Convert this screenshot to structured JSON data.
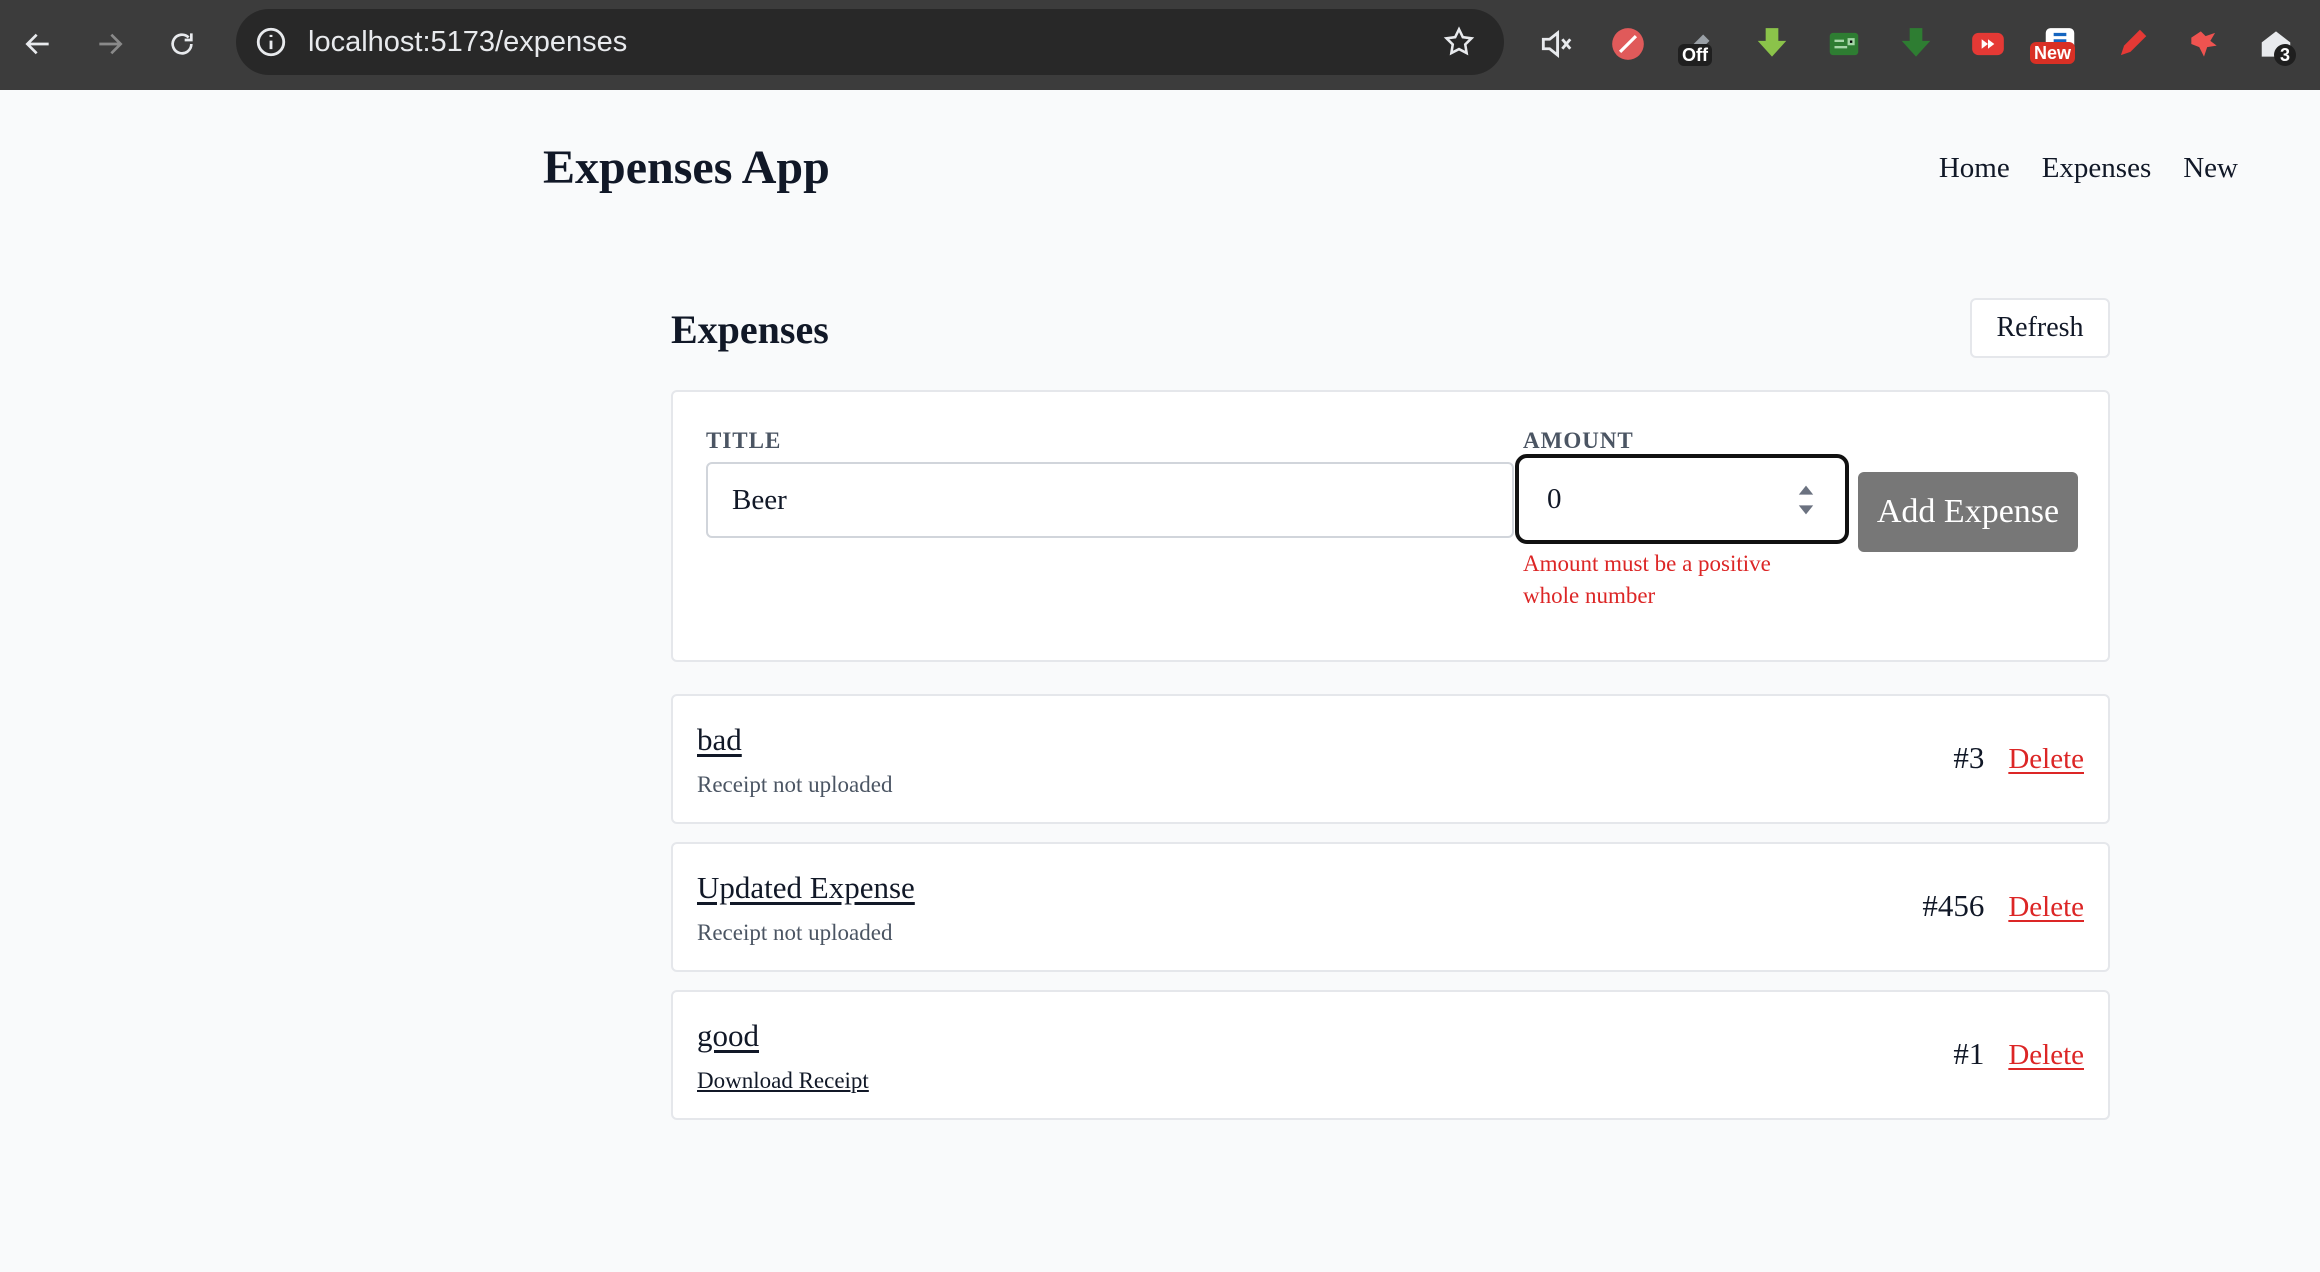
{
  "browser": {
    "url": "localhost:5173/expenses",
    "extensions": {
      "off_badge": "Off",
      "new_badge": "New",
      "count_badge": "3"
    }
  },
  "app": {
    "title": "Expenses App",
    "nav": [
      "Home",
      "Expenses",
      "New"
    ]
  },
  "page": {
    "title": "Expenses",
    "refresh_label": "Refresh"
  },
  "form": {
    "title_label": "TITLE",
    "title_value": "Beer",
    "amount_label": "AMOUNT",
    "amount_value": "0",
    "error": "Amount must be a positive whole number",
    "submit_label": "Add Expense"
  },
  "expenses": [
    {
      "title": "bad",
      "subtitle": "Receipt not uploaded",
      "id": "#3",
      "delete_label": "Delete"
    },
    {
      "title": "Updated Expense",
      "subtitle": "Receipt not uploaded",
      "id": "#456",
      "delete_label": "Delete"
    },
    {
      "title": "good",
      "subtitle": "Download Receipt",
      "id": "#1",
      "delete_label": "Delete"
    }
  ],
  "colors": {
    "error": "#dc2626",
    "button_disabled": "#777777",
    "chrome": "#3c3c3c"
  }
}
